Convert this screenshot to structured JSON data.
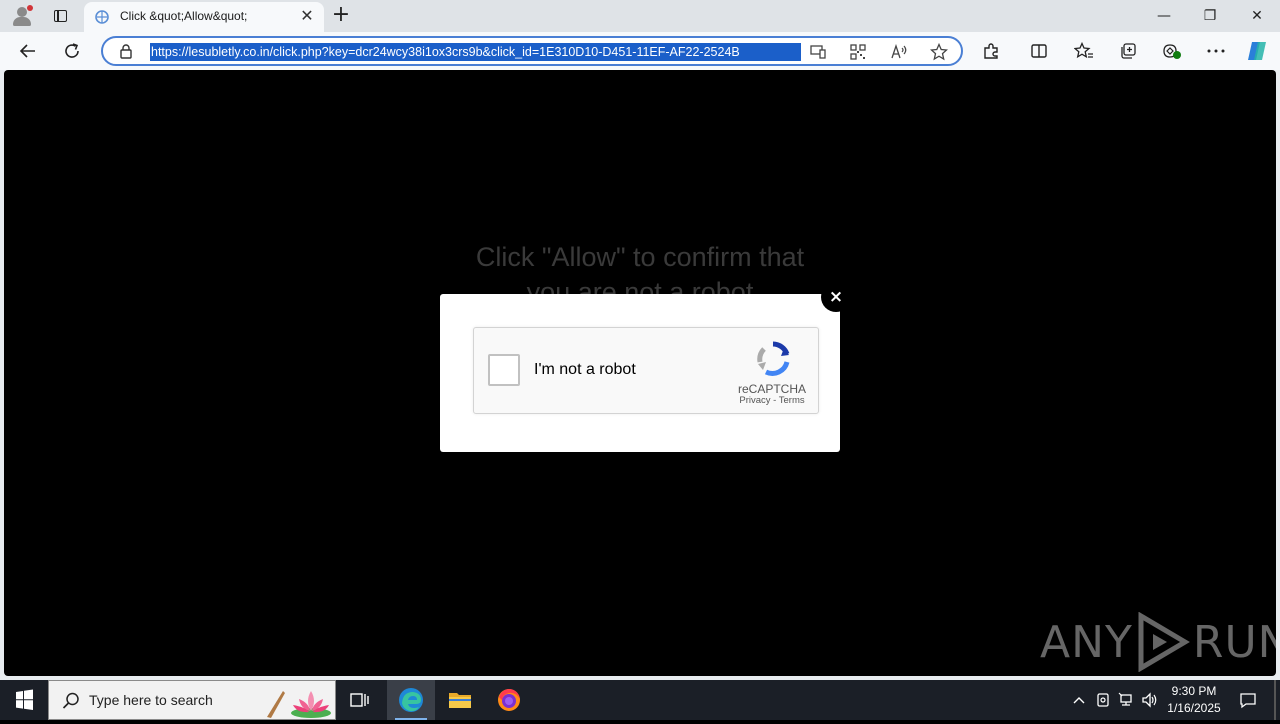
{
  "browser": {
    "tab_title": "Click &quot;Allow&quot;",
    "tab_close": "✕",
    "new_tab": "+",
    "window_controls": {
      "minimize": "—",
      "restore": "❐",
      "close": "✕"
    },
    "url": "https://lesubletly.co.in/click.php?key=dcr24wcy38i1ox3crs9b&click_id=1E310D10-D451-11EF-AF22-2524B"
  },
  "page": {
    "bg_line1": "Click \"Allow\" to confirm that",
    "bg_line2": "you are not a robot",
    "modal_close": "×",
    "captcha": {
      "label": "I'm not a robot",
      "brand": "reCAPTCHA",
      "links": "Privacy - Terms"
    },
    "watermark": {
      "left": "ANY",
      "right": "RUN"
    }
  },
  "taskbar": {
    "search_placeholder": "Type here to search",
    "time": "9:30 PM",
    "date": "1/16/2025"
  },
  "colors": {
    "accent": "#1b5fc9",
    "address_border": "#4a7fd4",
    "taskbar": "#1b1f27"
  }
}
